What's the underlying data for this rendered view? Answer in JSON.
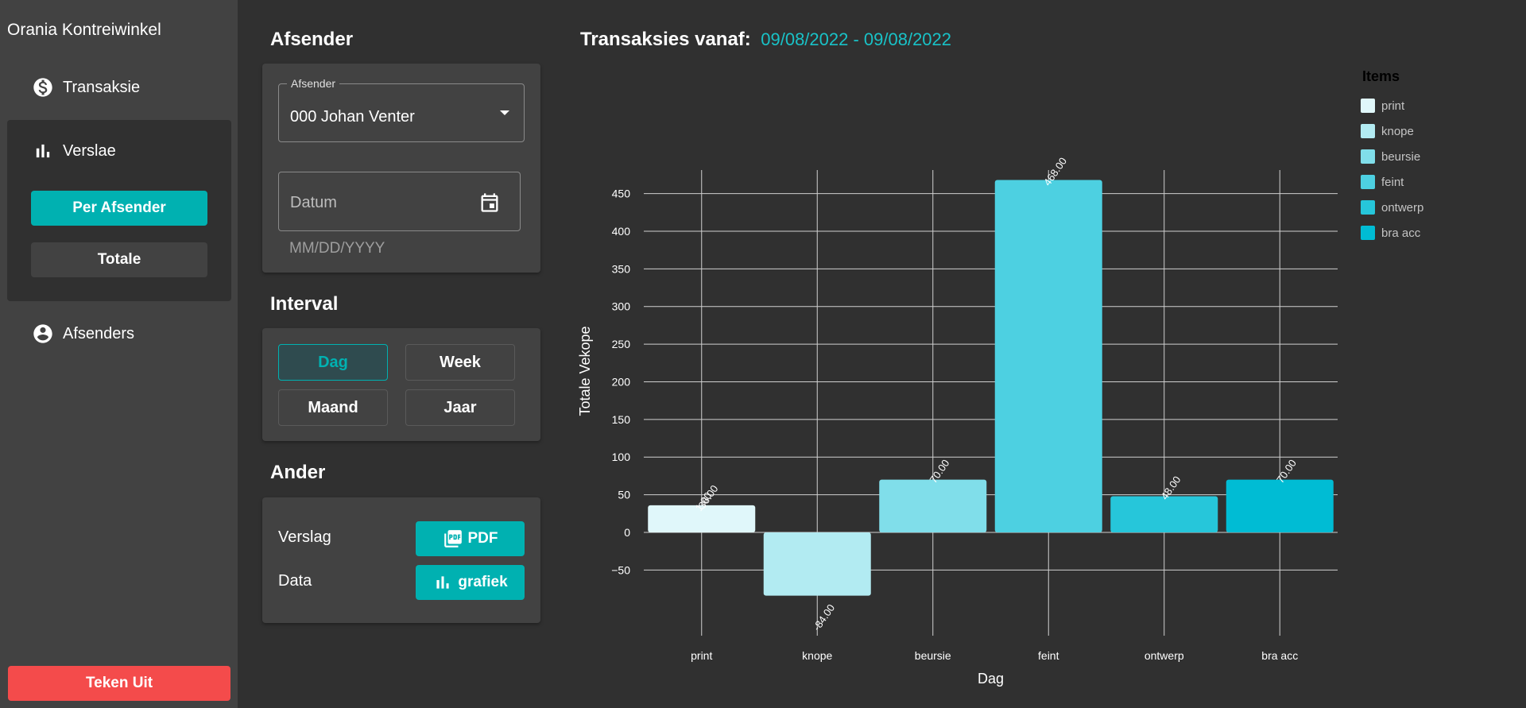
{
  "sidebar": {
    "app_title": "Orania Kontreiwinkel",
    "nav": {
      "transaksie": "Transaksie",
      "verslae": "Verslae",
      "afsenders": "Afsenders"
    },
    "verslae_buttons": {
      "per_afsender": "Per Afsender",
      "totale": "Totale"
    },
    "logout_label": "Teken Uit"
  },
  "afsender_section": {
    "title": "Afsender",
    "select_legend": "Afsender",
    "selected_value": "000 Johan Venter",
    "date_placeholder": "Datum",
    "date_format_hint": "MM/DD/YYYY"
  },
  "interval_section": {
    "title": "Interval",
    "options": [
      "Dag",
      "Week",
      "Maand",
      "Jaar"
    ],
    "selected": "Dag"
  },
  "ander_section": {
    "title": "Ander",
    "verslag_label": "Verslag",
    "data_label": "Data",
    "pdf_button": "PDF",
    "grafiek_button": "grafiek"
  },
  "chart_header": {
    "label": "Transaksies vanaf:",
    "range": "09/08/2022 - 09/08/2022"
  },
  "colors": {
    "accent": "#00b1b1",
    "danger": "#f44b4b",
    "background": "#303030",
    "surface": "#424242"
  },
  "chart_data": {
    "type": "bar",
    "categories": [
      "print",
      "knope",
      "beursie",
      "feint",
      "ontwerp",
      "bra acc"
    ],
    "values": [
      36,
      -84,
      70,
      468,
      48,
      70
    ],
    "value_labels": [
      "36.00",
      "-84.00",
      "70.00",
      "468.00",
      "48.00",
      "70.00"
    ],
    "extra_overlapping_label": "1.00",
    "colors": [
      "#e0f7fa",
      "#b2ebf2",
      "#80deea",
      "#4dd0e1",
      "#26c6da",
      "#00bcd4"
    ],
    "xlabel": "Dag",
    "ylabel": "Totale Vekope",
    "ylim": [
      -84,
      468
    ],
    "yticks": [
      -50,
      0,
      50,
      100,
      150,
      200,
      250,
      300,
      350,
      400,
      450
    ],
    "grid": true,
    "legend": {
      "title": "Items",
      "placement": "right",
      "entries": [
        "print",
        "knope",
        "beursie",
        "feint",
        "ontwerp",
        "bra acc"
      ]
    }
  }
}
